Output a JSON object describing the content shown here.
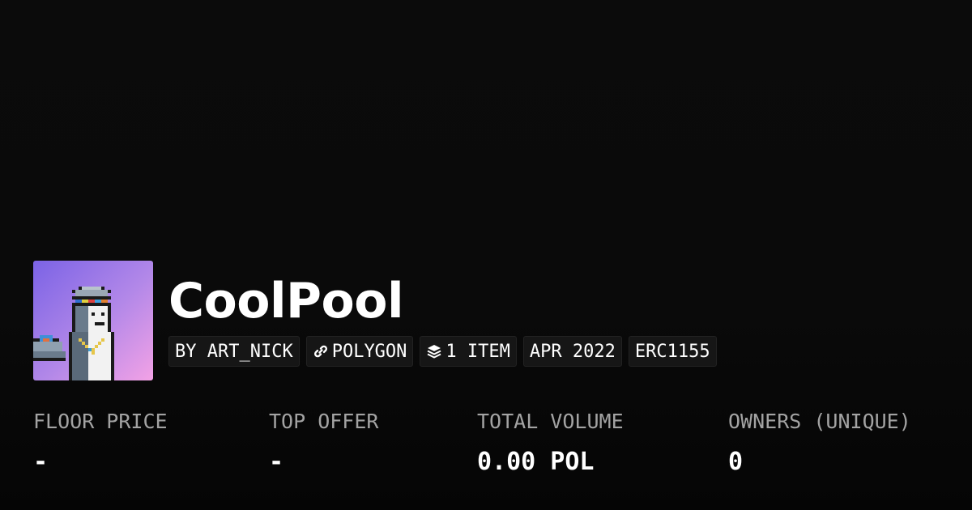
{
  "collection": {
    "name": "CoolPool",
    "avatar_icon": "pixel-penguin-avatar"
  },
  "chips": {
    "creator": "BY ART_NICK",
    "chain": "POLYGON",
    "chain_icon": "polygon-link-icon",
    "items": "1 ITEM",
    "items_icon": "layers-icon",
    "date": "APR 2022",
    "standard": "ERC1155"
  },
  "stats": {
    "floor_price_label": "FLOOR PRICE",
    "floor_price_value": "-",
    "top_offer_label": "TOP OFFER",
    "top_offer_value": "-",
    "total_volume_label": "TOTAL VOLUME",
    "total_volume_value": "0.00 POL",
    "owners_label": "OWNERS (UNIQUE)",
    "owners_value": "0"
  },
  "colors": {
    "background": "#0a0a0a",
    "chip_background": "#161616",
    "label_gray": "#a3a3a3",
    "avatar_gradient_start": "#7b63e6",
    "avatar_gradient_end": "#f3a2e6"
  }
}
